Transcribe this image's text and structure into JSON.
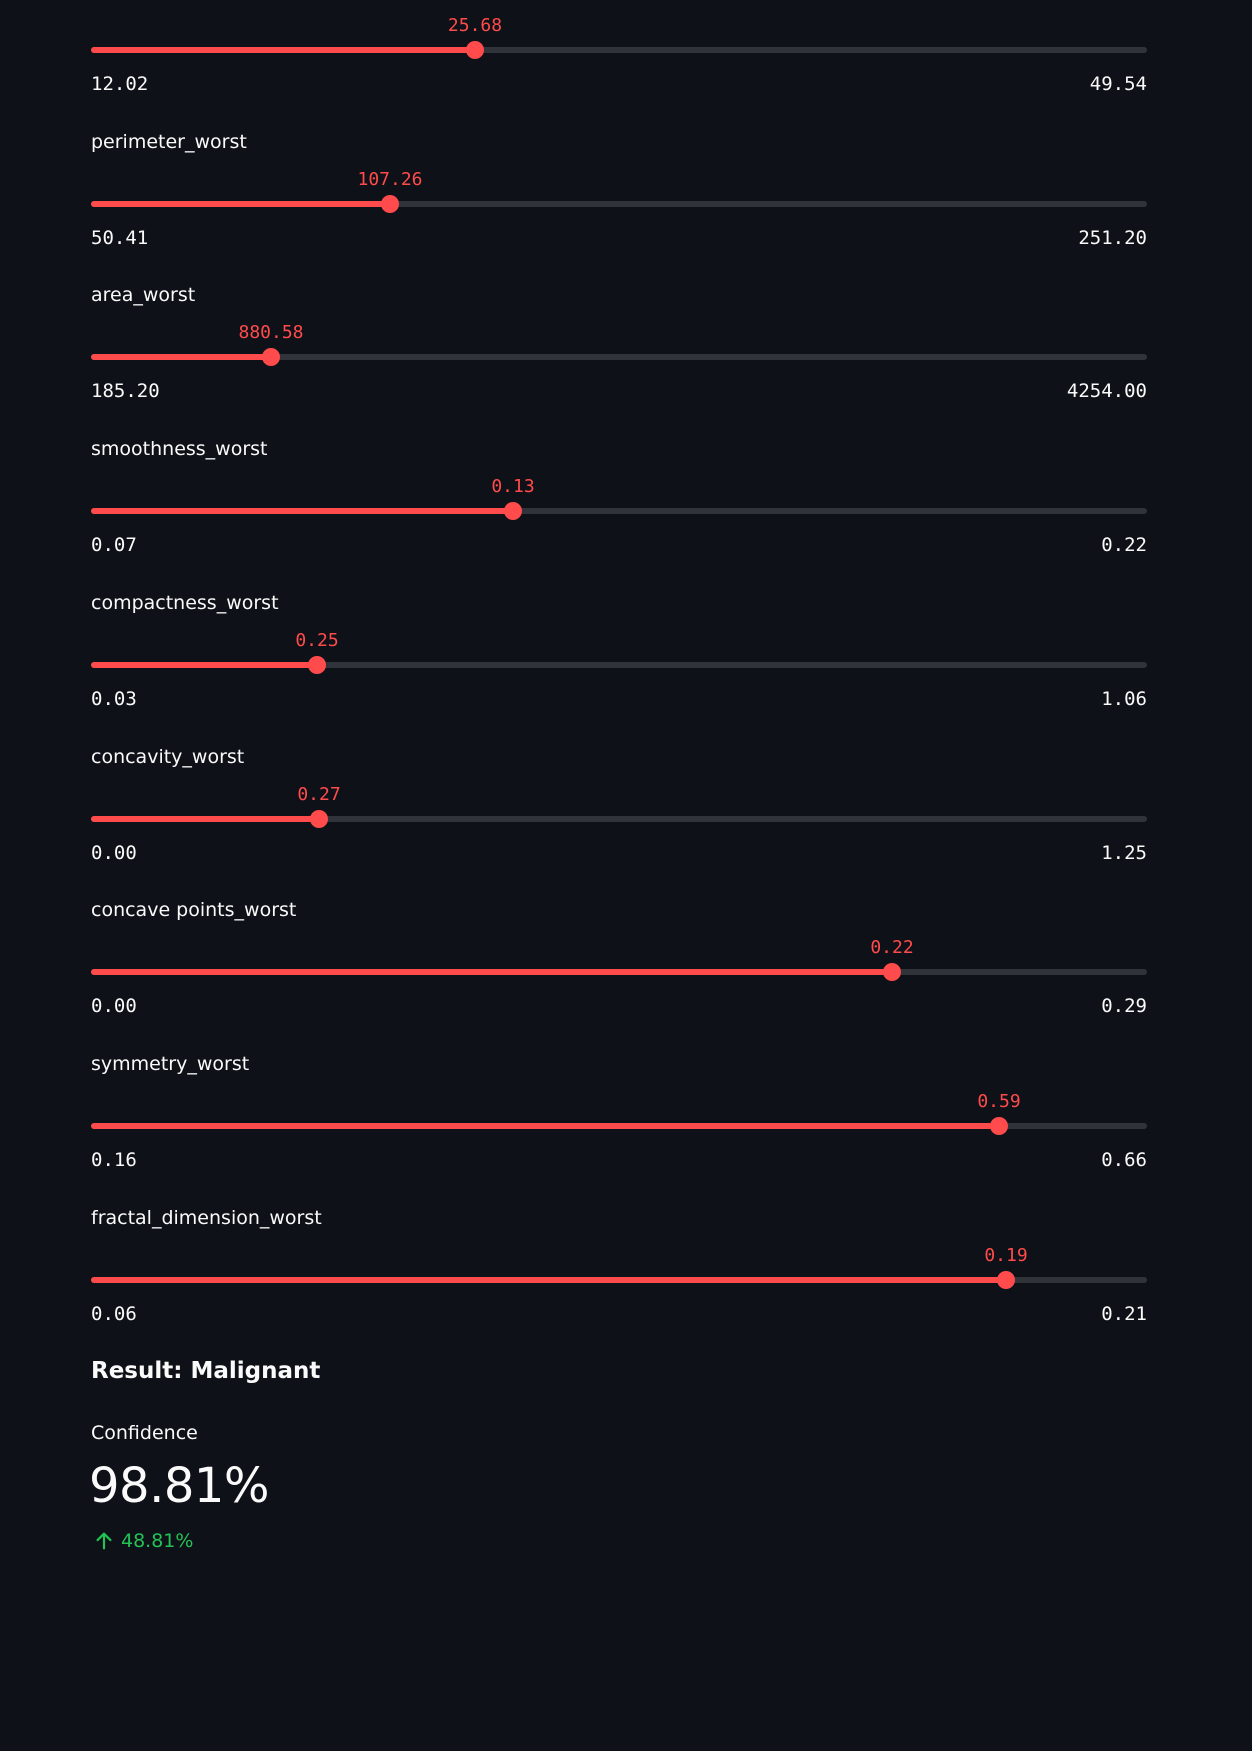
{
  "sliders": [
    {
      "label": "",
      "min": 12.02,
      "max": 49.54,
      "value": 25.68,
      "min_label": "12.02",
      "max_label": "49.54",
      "value_label": "25.68"
    },
    {
      "label": "perimeter_worst",
      "min": 50.41,
      "max": 251.2,
      "value": 107.26,
      "min_label": "50.41",
      "max_label": "251.20",
      "value_label": "107.26"
    },
    {
      "label": "area_worst",
      "min": 185.2,
      "max": 4254.0,
      "value": 880.58,
      "min_label": "185.20",
      "max_label": "4254.00",
      "value_label": "880.58"
    },
    {
      "label": "smoothness_worst",
      "min": 0.07,
      "max": 0.22,
      "value": 0.13,
      "min_label": "0.07",
      "max_label": "0.22",
      "value_label": "0.13"
    },
    {
      "label": "compactness_worst",
      "min": 0.03,
      "max": 1.06,
      "value": 0.25,
      "min_label": "0.03",
      "max_label": "1.06",
      "value_label": "0.25"
    },
    {
      "label": "concavity_worst",
      "min": 0.0,
      "max": 1.25,
      "value": 0.27,
      "min_label": "0.00",
      "max_label": "1.25",
      "value_label": "0.27"
    },
    {
      "label": "concave points_worst",
      "min": 0.0,
      "max": 0.29,
      "value": 0.22,
      "min_label": "0.00",
      "max_label": "0.29",
      "value_label": "0.22"
    },
    {
      "label": "symmetry_worst",
      "min": 0.16,
      "max": 0.66,
      "value": 0.59,
      "min_label": "0.16",
      "max_label": "0.66",
      "value_label": "0.59"
    },
    {
      "label": "fractal_dimension_worst",
      "min": 0.06,
      "max": 0.21,
      "value": 0.19,
      "min_label": "0.06",
      "max_label": "0.21",
      "value_label": "0.19"
    }
  ],
  "result": {
    "heading": "Result: Malignant"
  },
  "metric": {
    "label": "Confidence",
    "value": "98.81%",
    "delta": "48.81%",
    "delta_icon": "arrow-up-icon",
    "delta_color": "#21c354"
  },
  "colors": {
    "background": "#0e1117",
    "accent": "#ff4b4b",
    "track": "#31333b",
    "text": "#fafafa"
  }
}
